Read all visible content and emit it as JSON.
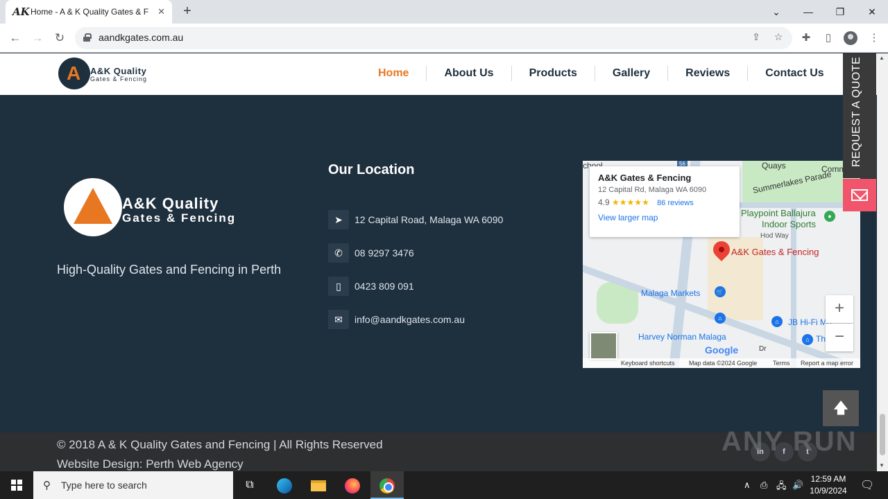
{
  "browser": {
    "tab_title": "Home - A & K Quality Gates & F",
    "tab_favicon": "AK",
    "url": "aandkgates.com.au"
  },
  "site": {
    "logo_name": "A&K",
    "logo_name_small": "A&K Quality",
    "logo_sub_small": "Gates & Fencing",
    "logo_line1": "A&K Quality",
    "logo_line2": "Gates & Fencing",
    "nav": [
      "Home",
      "About Us",
      "Products",
      "Gallery",
      "Reviews",
      "Contact Us"
    ],
    "active_nav": "Home",
    "tagline": "High-Quality Gates and Fencing in Perth",
    "location_title": "Our Location",
    "contacts": [
      {
        "icon": "location-arrow-icon",
        "text": "12 Capital Road, Malaga WA 6090"
      },
      {
        "icon": "phone-icon",
        "text": "08 9297 3476"
      },
      {
        "icon": "mobile-icon",
        "text": "0423 809 091"
      },
      {
        "icon": "envelope-icon",
        "text": "info@aandkgates.com.au"
      }
    ],
    "request_quote": "REQUEST A QUOTE",
    "copyright": "© 2018 A & K Quality Gates and Fencing | All Rights Reserved",
    "design_credit": "Website Design: Perth Web Agency",
    "social": [
      "in",
      "f",
      "t"
    ],
    "watermark": "ANY RUN"
  },
  "map": {
    "place_name": "A&K Gates & Fencing",
    "place_address": "12 Capital Rd, Malaga WA 6090",
    "rating": "4.9",
    "stars": "★★★★★",
    "reviews": "86 reviews",
    "larger_map": "View larger map",
    "labels": {
      "school": "chool",
      "quays": "Quays",
      "commun": "Commun",
      "summerlakes": "Summerlakes Parade",
      "playpoint": "Playpoint Ballajura",
      "indoor": "Indoor Sports",
      "hodway": "Hod Way",
      "pin_label": "A&K Gates & Fencing",
      "markets": "Malaga Markets",
      "jb": "JB Hi-Fi Ma",
      "harvey": "Harvey Norman Malaga",
      "t": "Th",
      "dr": "Dr",
      "route": "56"
    },
    "google": "Google",
    "attribution": [
      "Keyboard shortcuts",
      "Map data ©2024 Google",
      "Terms",
      "Report a map error"
    ],
    "zoom_in": "+",
    "zoom_out": "−"
  },
  "taskbar": {
    "search_placeholder": "Type here to search",
    "time": "12:59 AM",
    "date": "10/9/2024"
  }
}
